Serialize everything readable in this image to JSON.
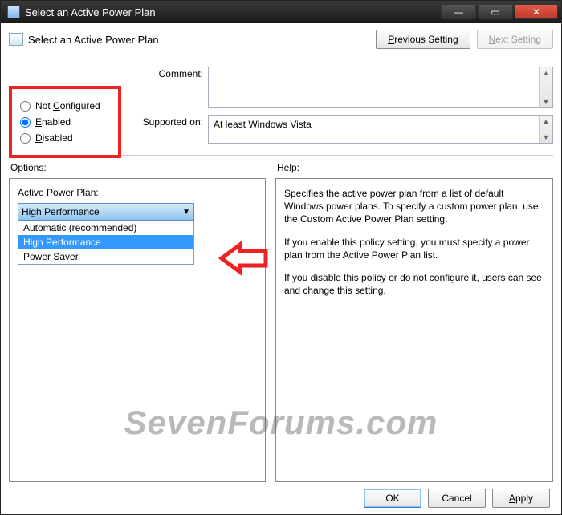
{
  "window": {
    "title": "Select an Active Power Plan",
    "min": "—",
    "max": "▭",
    "close": "✕"
  },
  "page_heading": "Select an Active Power Plan",
  "nav": {
    "prev_full": "Previous Setting",
    "prev_u": "P",
    "next_full": "Next Setting",
    "next_u": "N"
  },
  "state": {
    "not_configured": "Not Configured",
    "not_configured_u": "C",
    "enabled": "Enabled",
    "enabled_u": "E",
    "disabled": "Disabled",
    "disabled_u": "D",
    "selected": "enabled"
  },
  "fields": {
    "comment_label": "Comment:",
    "comment_value": "",
    "supported_label": "Supported on:",
    "supported_value": "At least Windows Vista"
  },
  "sections": {
    "options": "Options:",
    "help": "Help:"
  },
  "options": {
    "plan_label": "Active Power Plan:",
    "plan_selected": "High Performance",
    "plan_list": {
      "0": "Automatic (recommended)",
      "1": "High Performance",
      "2": "Power Saver"
    }
  },
  "help": {
    "p1": "Specifies the active power plan from a list of default Windows power plans. To specify a custom power plan, use the Custom Active Power Plan setting.",
    "p2": "If you enable this policy setting, you must specify a power plan from the Active Power Plan list.",
    "p3": "If you disable this policy or do not configure it, users can see and change this setting."
  },
  "buttons": {
    "ok": "OK",
    "cancel": "Cancel",
    "apply": "Apply",
    "apply_u": "A"
  },
  "watermark": "SevenForums.com"
}
